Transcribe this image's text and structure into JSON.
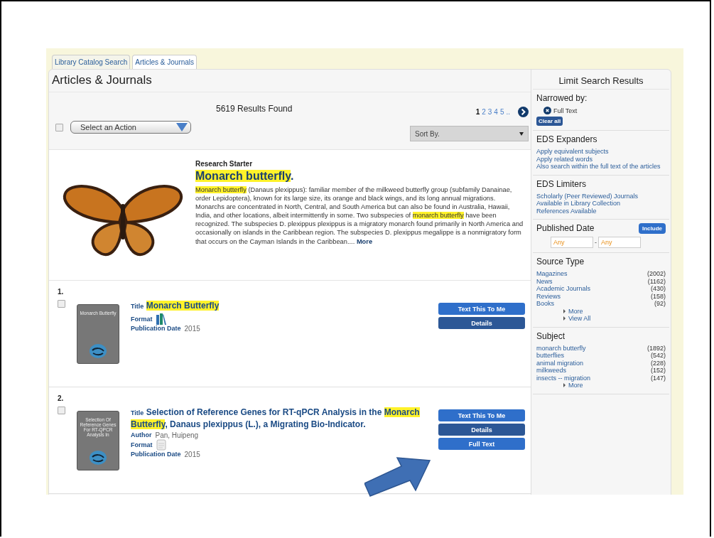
{
  "tabs": [
    {
      "label": "Library Catalog Search",
      "selected": false
    },
    {
      "label": "Articles & Journals",
      "selected": true
    }
  ],
  "page_title": "Articles & Journals",
  "toolbar": {
    "select_all_checked": false,
    "action_select": "Select an Action",
    "results_count": "5619 Results Found",
    "pages": [
      {
        "label": "1",
        "selected": true
      },
      {
        "label": "2",
        "selected": false
      },
      {
        "label": "3",
        "selected": false
      },
      {
        "label": "4",
        "selected": false
      },
      {
        "label": "5",
        "selected": false
      }
    ],
    "pages_more": "..",
    "sort": "Sort By."
  },
  "research_starter": {
    "label": "Research Starter",
    "title": [
      {
        "text": "Monarch butterfly",
        "highlighted": true
      },
      {
        "text": ".",
        "highlighted": false
      }
    ],
    "summary": [
      {
        "text": "Monarch butterfly",
        "highlighted": true
      },
      {
        "text": " (Danaus plexippus): familiar member of the milkweed butterfly group (subfamily Danainae, order Lepidoptera), known for its large size, its orange and black wings, and its long annual migrations. Monarchs are concentrated in North, Central, and South America but can also be found in Australia, Hawaii, India, and other locations, albeit intermittently in some. Two subspecies of ",
        "highlighted": false
      },
      {
        "text": "monarch butterfly",
        "highlighted": true
      },
      {
        "text": " have been recognized. The subspecies D. plexippus plexippus is a migratory monarch found primarily in North America and occasionally on islands in the Caribbean region. The subspecies D. plexippus megalippe is a nonmigratory form that occurs on the Cayman Islands in the Caribbean.... ",
        "highlighted": false
      }
    ],
    "more": "More"
  },
  "results": [
    {
      "number": "1.",
      "checked": false,
      "cover_text": "Monarch Butterfly",
      "title_label": "Title",
      "title": [
        {
          "text": "Monarch Butterfly",
          "highlighted": true
        }
      ],
      "fields": [
        {
          "label": "Format",
          "kind": "book"
        },
        {
          "label": "Publication Date",
          "value": "2015",
          "kind": "text"
        }
      ],
      "buttons": [
        {
          "label": "Text This To Me",
          "kind": "light"
        },
        {
          "label": "Details",
          "kind": "dark"
        }
      ]
    },
    {
      "number": "2.",
      "checked": false,
      "cover_text": "Selection Of Reference Genes For RT-QPCR Analysis In",
      "title_label": "Title",
      "title": [
        {
          "text": "Selection of Reference Genes for RT-qPCR Analysis in the ",
          "highlighted": false
        },
        {
          "text": "Monarch Butterfly",
          "highlighted": true
        },
        {
          "text": ", Danaus plexippus (L.), a Migrating Bio-Indicator.",
          "highlighted": false
        }
      ],
      "fields": [
        {
          "label": "Author",
          "value": "Pan, Huipeng",
          "kind": "text"
        },
        {
          "label": "Format",
          "kind": "document"
        },
        {
          "label": "Publication Date",
          "value": "2015",
          "kind": "text"
        }
      ],
      "buttons": [
        {
          "label": "Text This To Me",
          "kind": "light"
        },
        {
          "label": "Details",
          "kind": "dark"
        },
        {
          "label": "Full Text",
          "kind": "light"
        }
      ]
    }
  ],
  "sidebar": {
    "title": "Limit Search Results",
    "narrowed_label": "Narrowed by:",
    "narrowed": [
      "Full Text"
    ],
    "clear_all": "Clear all",
    "expanders": {
      "title": "EDS Expanders",
      "links": [
        "Apply equivalent subjects",
        "Apply related words",
        "Also search within the full text of the articles"
      ]
    },
    "limiters": {
      "title": "EDS Limiters",
      "links": [
        "Scholarly (Peer Reviewed) Journals",
        "Available in Library Collection",
        "References Available"
      ]
    },
    "published": {
      "title": "Published Date",
      "include": "Include",
      "from_placeholder": "Any",
      "separator": "-",
      "to_placeholder": "Any"
    },
    "facets": [
      {
        "title": "Source Type",
        "items": [
          {
            "label": "Magazines",
            "count": "(2002)"
          },
          {
            "label": "News",
            "count": "(1162)"
          },
          {
            "label": "Academic Journals",
            "count": "(430)"
          },
          {
            "label": "Reviews",
            "count": "(158)"
          },
          {
            "label": "Books",
            "count": "(92)"
          }
        ],
        "links": [
          "More",
          "View All"
        ]
      },
      {
        "title": "Subject",
        "items": [
          {
            "label": "monarch butterfly",
            "count": "(1892)"
          },
          {
            "label": "butterflies",
            "count": "(542)"
          },
          {
            "label": "animal migration",
            "count": "(228)"
          },
          {
            "label": "milkweeds",
            "count": "(152)"
          },
          {
            "label": "insects -- migration",
            "count": "(147)"
          }
        ],
        "links": [
          "More"
        ]
      }
    ]
  }
}
